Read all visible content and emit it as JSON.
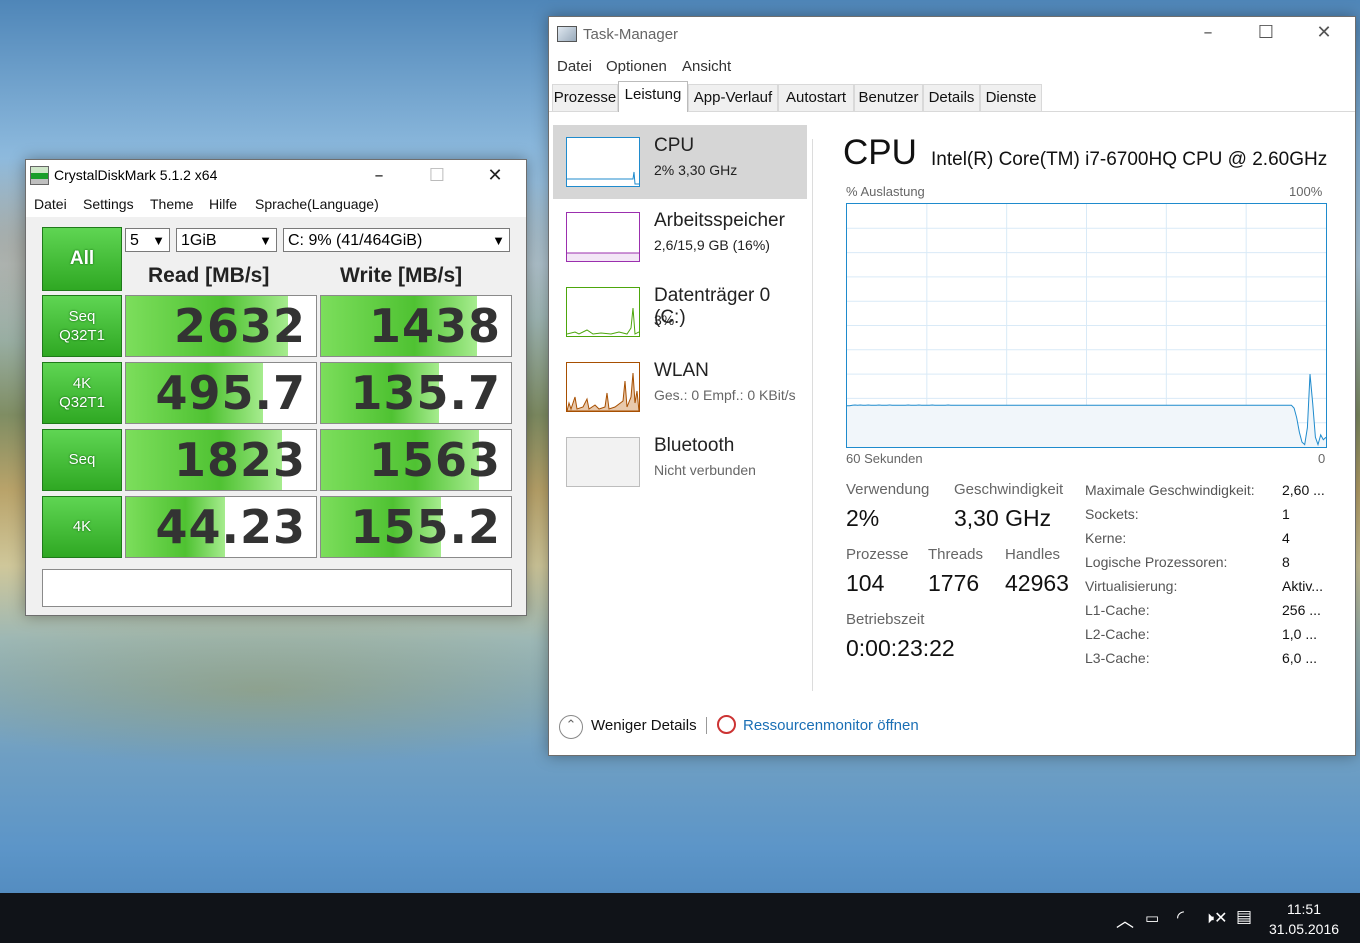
{
  "crystal": {
    "title": "CrystalDiskMark 5.1.2 x64",
    "menu": [
      "Datei",
      "Settings",
      "Theme",
      "Hilfe",
      "Sprache(Language)"
    ],
    "all_label": "All",
    "count": "5",
    "size": "1GiB",
    "drive": "C: 9% (41/464GiB)",
    "read_header": "Read [MB/s]",
    "write_header": "Write [MB/s]",
    "rows": [
      {
        "label": "Seq\nQ32T1",
        "read": "2632",
        "write": "1438",
        "read_fill": 0.85,
        "write_fill": 0.82
      },
      {
        "label": "4K\nQ32T1",
        "read": "495.7",
        "write": "135.7",
        "read_fill": 0.72,
        "write_fill": 0.62
      },
      {
        "label": "Seq",
        "read": "1823",
        "write": "1563",
        "read_fill": 0.82,
        "write_fill": 0.83
      },
      {
        "label": "4K",
        "read": "44.23",
        "write": "155.2",
        "read_fill": 0.52,
        "write_fill": 0.63
      }
    ],
    "status": ""
  },
  "taskmanager": {
    "title": "Task-Manager",
    "menu": [
      "Datei",
      "Optionen",
      "Ansicht"
    ],
    "tabs": [
      "Prozesse",
      "Leistung",
      "App-Verlauf",
      "Autostart",
      "Benutzer",
      "Details",
      "Dienste"
    ],
    "active_tab": "Leistung",
    "sidebar": [
      {
        "name": "CPU",
        "sub": "2% 3,30 GHz",
        "color": "#1f8bcd"
      },
      {
        "name": "Arbeitsspeicher",
        "sub": "2,6/15,9 GB (16%)",
        "color": "#9b2fae"
      },
      {
        "name": "Datenträger 0 (C:)",
        "sub": "3%",
        "color": "#4da60c"
      },
      {
        "name": "WLAN",
        "sub": "Ges.: 0 Empf.: 0 KBit/s",
        "color": "#a74f01"
      },
      {
        "name": "Bluetooth",
        "sub": "Nicht verbunden",
        "color": "#8a8a8a"
      }
    ],
    "heading": "CPU",
    "cpu_name": "Intel(R) Core(TM) i7-6700HQ CPU @ 2.60GHz",
    "graph_label_left": "% Auslastung",
    "graph_label_right": "100%",
    "graph_time_left": "60 Sekunden",
    "graph_time_right": "0",
    "graph_values": [
      17,
      17,
      17.2,
      17.3,
      17.2,
      17.3,
      17.2,
      17.2,
      17.3,
      17.2,
      17.2,
      17.2,
      17.3,
      17.2,
      17.2,
      17.2,
      17.3,
      17.2,
      17.2,
      17.2,
      17.2,
      17.2,
      17.2,
      17.3,
      17.2,
      17.2,
      17.2,
      17.3,
      17.2,
      17.2,
      17.2,
      17.2,
      17.3,
      17.2,
      17.2,
      17.2,
      17.2,
      17.2,
      17.3,
      17.2,
      17.2,
      17.2,
      17.2,
      17.2,
      17.2,
      17.2,
      17.2,
      17.2,
      17.2,
      17.2,
      17.2,
      17.2,
      17.2,
      17.2,
      17.2,
      17.2,
      17.2,
      17.2,
      17.2,
      17.2,
      17.2,
      17.2,
      17.2,
      17.2,
      17.2,
      17.2,
      17.2,
      17.2,
      17.2,
      17.2,
      17.2,
      17.2,
      17.2,
      17.2,
      17.2,
      17.2,
      17.2,
      17.2,
      17.2,
      17.2,
      17.2,
      17.2,
      17.2,
      17.2,
      17.2,
      17.2,
      17.2,
      17.2,
      17.2,
      17.2,
      17.2,
      17.2,
      17.2,
      17.2,
      17.2,
      17.2,
      17.2,
      17.2,
      17.2,
      17.2,
      17.2,
      17.2,
      17.2,
      17.2,
      17.2,
      17.2,
      17.2,
      17.2,
      17.2,
      17.2,
      17.2,
      17.2,
      17.2,
      17.2,
      17.2,
      17.2,
      17.2,
      17.2,
      17.2,
      17.2,
      17.2,
      17.2,
      17.2,
      17.2,
      17.2,
      17.2,
      17.2,
      17.2,
      17.2,
      17.2,
      17.2,
      17.2,
      17.2,
      17.2,
      17.2,
      17.2,
      17.2,
      17.2,
      17.2,
      17.2,
      17.2,
      17.2,
      17.2,
      17.2,
      17.2,
      17.2,
      17.2,
      17.2,
      17.2,
      17.2,
      17.2,
      17.2,
      17.2,
      17.2,
      17.2,
      17.2,
      17.2,
      17.2,
      17.2,
      17.2,
      17.2,
      17.2,
      17.2,
      17.2,
      17.2,
      17.2,
      17.2,
      17.2,
      16,
      12,
      6,
      2,
      1,
      8,
      30,
      18,
      4,
      1,
      5,
      3,
      4
    ],
    "stats": {
      "usage_label": "Verwendung",
      "usage": "2%",
      "speed_label": "Geschwindigkeit",
      "speed": "3,30 GHz",
      "proc_label": "Prozesse",
      "proc": "104",
      "threads_label": "Threads",
      "threads": "1776",
      "handles_label": "Handles",
      "handles": "42963",
      "uptime_label": "Betriebszeit",
      "uptime": "0:00:23:22"
    },
    "details": [
      {
        "k": "Maximale Geschwindigkeit:",
        "v": "2,60 ..."
      },
      {
        "k": "Sockets:",
        "v": "1"
      },
      {
        "k": "Kerne:",
        "v": "4"
      },
      {
        "k": "Logische Prozessoren:",
        "v": "8"
      },
      {
        "k": "Virtualisierung:",
        "v": "Aktiv..."
      },
      {
        "k": "L1-Cache:",
        "v": "256 ..."
      },
      {
        "k": "L2-Cache:",
        "v": "1,0 ..."
      },
      {
        "k": "L3-Cache:",
        "v": "6,0 ..."
      }
    ],
    "less_details": "Weniger Details",
    "resmon_link": "Ressourcenmonitor öffnen"
  },
  "taskbar": {
    "time": "11:51",
    "date": "31.05.2016"
  }
}
